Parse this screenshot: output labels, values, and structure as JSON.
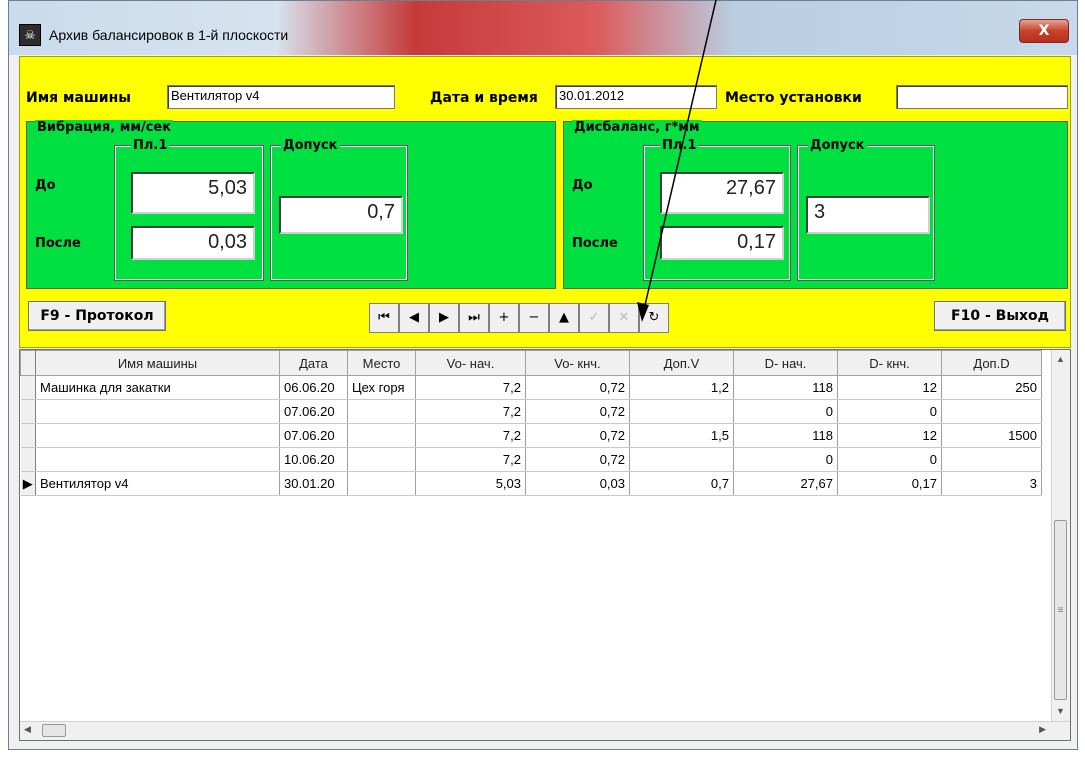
{
  "window": {
    "title": "Архив балансировок в 1-й плоскости",
    "close_label": "X"
  },
  "form": {
    "machine_name_label": "Имя машины",
    "machine_name_value": "Вентилятор v4",
    "datetime_label": "Дата и время",
    "datetime_value": "30.01.2012",
    "location_label": "Место установки",
    "location_value": ""
  },
  "vibration": {
    "group_title": "Вибрация, мм/сек",
    "plane_title": "Пл.1",
    "tolerance_title": "Допуск",
    "before_label": "До",
    "after_label": "После",
    "before_value": "5,03",
    "after_value": "0,03",
    "tolerance_value": "0,7"
  },
  "imbalance": {
    "group_title": "Дисбаланс, г*мм",
    "plane_title": "Пл.1",
    "tolerance_title": "Допуск",
    "before_label": "До",
    "after_label": "После",
    "before_value": "27,67",
    "after_value": "0,17",
    "tolerance_value": "3"
  },
  "toolbar": {
    "protocol_label": "F9 - Протокол",
    "exit_label": "F10 - Выход",
    "nav": [
      {
        "glyph": "⏮",
        "name": "nav-first-button",
        "disabled": false
      },
      {
        "glyph": "◀",
        "name": "nav-prior-button",
        "disabled": false
      },
      {
        "glyph": "▶",
        "name": "nav-next-button",
        "disabled": false
      },
      {
        "glyph": "⏭",
        "name": "nav-last-button",
        "disabled": false
      },
      {
        "glyph": "+",
        "name": "nav-insert-button",
        "disabled": false
      },
      {
        "glyph": "−",
        "name": "nav-delete-button",
        "disabled": false
      },
      {
        "glyph": "▲",
        "name": "nav-edit-button",
        "disabled": false
      },
      {
        "glyph": "✓",
        "name": "nav-post-button",
        "disabled": true
      },
      {
        "glyph": "✕",
        "name": "nav-cancel-button",
        "disabled": true
      },
      {
        "glyph": "↻",
        "name": "nav-refresh-button",
        "disabled": false
      }
    ]
  },
  "grid": {
    "columns": [
      "Имя машины",
      "Дата",
      "Место",
      "Vo- нач.",
      "Vo- кнч.",
      "Доп.V",
      "D- нач.",
      "D- кнч.",
      "Доп.D"
    ],
    "rows": [
      [
        "Машинка для закатки",
        "06.06.20",
        "Цех горя",
        "7,2",
        "0,72",
        "1,2",
        "118",
        "12",
        "250"
      ],
      [
        "",
        "07.06.20",
        "",
        "7,2",
        "0,72",
        "",
        "0",
        "0",
        ""
      ],
      [
        "",
        "07.06.20",
        "",
        "7,2",
        "0,72",
        "1,5",
        "118",
        "12",
        "1500"
      ],
      [
        "",
        "10.06.20",
        "",
        "7,2",
        "0,72",
        "",
        "0",
        "0",
        ""
      ],
      [
        "Вентилятор v4",
        "30.01.20",
        "",
        "5,03",
        "0,03",
        "0,7",
        "27,67",
        "0,17",
        "3"
      ]
    ],
    "current_row": 4,
    "current_marker": "▶"
  },
  "colors": {
    "panel": "#ffff00",
    "group": "#00e040"
  }
}
